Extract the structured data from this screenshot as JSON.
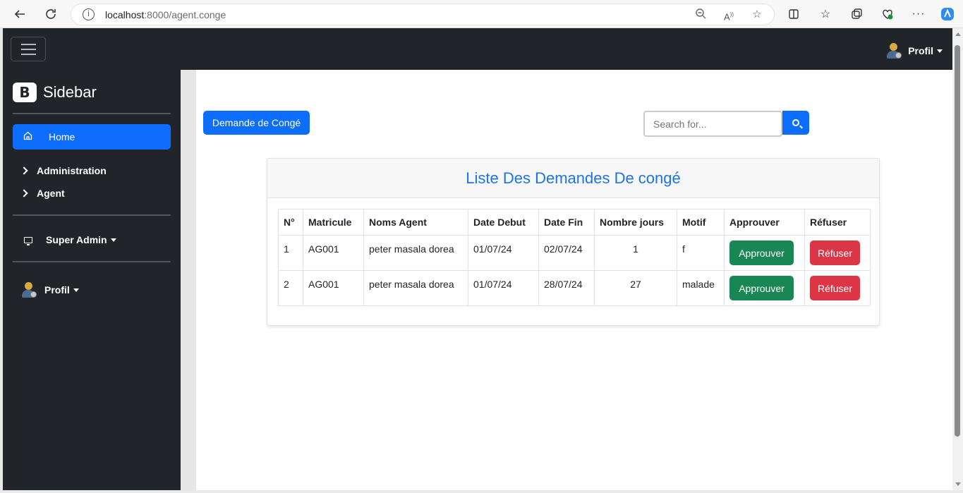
{
  "browser": {
    "url_host": "localhost",
    "url_path": ":8000/agent.conge"
  },
  "topbar": {
    "profile_label": "Profil"
  },
  "sidebar": {
    "brand_letter": "B",
    "brand_text": "Sidebar",
    "home_label": "Home",
    "items": [
      {
        "label": "Administration"
      },
      {
        "label": "Agent"
      }
    ],
    "super_admin_label": "Super Admin",
    "profile_label": "Profil"
  },
  "main": {
    "demande_button": "Demande de Congé",
    "search_placeholder": "Search for...",
    "card_title": "Liste Des Demandes De congé",
    "table": {
      "headers": [
        "N°",
        "Matricule",
        "Noms Agent",
        "Date Debut",
        "Date Fin",
        "Nombre jours",
        "Motif",
        "Approuver",
        "Réfuser"
      ],
      "rows": [
        {
          "n": "1",
          "matricule": "AG001",
          "nom": "peter masala dorea",
          "debut": "01/07/24",
          "fin": "02/07/24",
          "jours": "1",
          "motif": "f",
          "approve": "Approuver",
          "refuse": "Réfuser"
        },
        {
          "n": "2",
          "matricule": "AG001",
          "nom": "peter masala dorea",
          "debut": "01/07/24",
          "fin": "28/07/24",
          "jours": "27",
          "motif": "malade",
          "approve": "Approuver",
          "refuse": "Réfuser"
        }
      ]
    }
  },
  "colors": {
    "primary": "#0d6efd",
    "success": "#198754",
    "danger": "#dc3545",
    "dark": "#212529",
    "title_blue": "#1f73e8"
  }
}
